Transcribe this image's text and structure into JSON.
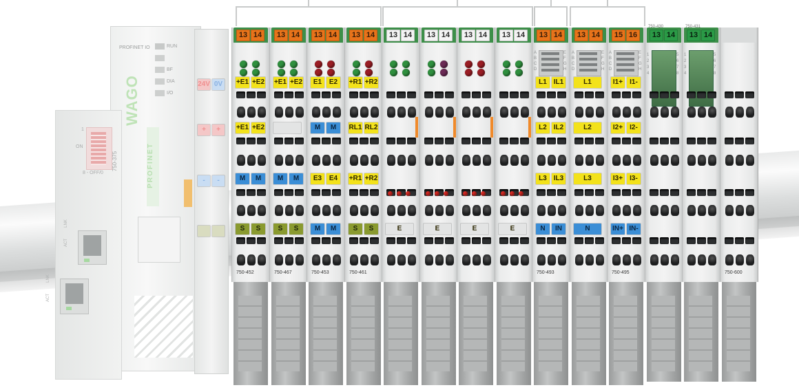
{
  "bracket_groups": 6,
  "coupler": {
    "brand": "WAGO",
    "protocol_label": "PROFINET IO",
    "led_labels": [
      "RUN",
      "BF",
      "DIA",
      "I/O"
    ],
    "model": "750-375",
    "dip_on": "ON",
    "dip_scale": "8 - OFF/0",
    "dip_one": "1",
    "port_labels": [
      "ACT",
      "LNK"
    ],
    "logo_text": "PROFINET"
  },
  "power_module": {
    "top_labels": [
      "24V",
      "0V"
    ],
    "mid_labels": [
      "+",
      "+"
    ],
    "low_labels": [
      "-",
      "-"
    ],
    "bottom_labels": [
      "",
      ""
    ]
  },
  "modules": [
    {
      "id": "m1",
      "nums": [
        "13",
        "14"
      ],
      "num_color": "#e8731a",
      "num_text_color": "#3a1e08",
      "led_colors": [
        "#2f8f3e",
        "#2f8f3e"
      ],
      "row1": [
        "+E1",
        "+E2"
      ],
      "row1_color": "#f3e21b",
      "row2": [
        "+E1",
        "+E2"
      ],
      "row2_color": "#f3e21b",
      "row3": [
        "M",
        "M"
      ],
      "row3_color": "#3b8ed6",
      "row4": [
        "S",
        "S"
      ],
      "row4_color": "#8a9a2f",
      "model": "750-452"
    },
    {
      "id": "m2",
      "nums": [
        "13",
        "14"
      ],
      "num_color": "#e8731a",
      "num_text_color": "#3a1e08",
      "led_colors": [
        "#2f8f3e",
        "#2f8f3e"
      ],
      "row1": [
        "+E1",
        "+E2"
      ],
      "row1_color": "#f3e21b",
      "row2": [
        "",
        ""
      ],
      "row2_color": "#e3e4e4",
      "row3": [
        "M",
        "M"
      ],
      "row3_color": "#3b8ed6",
      "row4": [
        "S",
        "S"
      ],
      "row4_color": "#8a9a2f",
      "model": "750-467"
    },
    {
      "id": "m3",
      "nums": [
        "13",
        "14"
      ],
      "num_color": "#e8731a",
      "num_text_color": "#3a1e08",
      "led_colors": [
        "#9a1d24",
        "#9a1d24"
      ],
      "row1": [
        "E1",
        "E2"
      ],
      "row1_color": "#f3e21b",
      "row2": [
        "M",
        "M"
      ],
      "row2_color": "#3b8ed6",
      "row3": [
        "E3",
        "E4"
      ],
      "row3_color": "#f3e21b",
      "row4": [
        "M",
        "M"
      ],
      "row4_color": "#3b8ed6",
      "model": "750-453"
    },
    {
      "id": "m4",
      "nums": [
        "13",
        "14"
      ],
      "num_color": "#e8731a",
      "num_text_color": "#3a1e08",
      "led_colors": [
        "#2f8f3e",
        "#9a1d24"
      ],
      "row1": [
        "+R1",
        "+R2"
      ],
      "row1_color": "#f3e21b",
      "row2": [
        "RL1",
        "RL2"
      ],
      "row2_color": "#f3e21b",
      "row3": [
        "+R1",
        "+R2"
      ],
      "row3_color": "#f3e21b",
      "row4": [
        "S",
        "S"
      ],
      "row4_color": "#8a9a2f",
      "model": "750-461"
    },
    {
      "id": "m5",
      "nums": [
        "13",
        "14"
      ],
      "num_color": "#f4f4f4",
      "num_text_color": "#2a2a2a",
      "led_colors": [
        "#2f8f3e",
        "#2f8f3e"
      ],
      "row1": [
        "",
        ""
      ],
      "row1_color": "",
      "row2": [
        "",
        ""
      ],
      "row2_color": "",
      "row3": [
        "",
        ""
      ],
      "row3_color": "",
      "row4": [
        "E",
        ""
      ],
      "row4_color": "#e3e4e4",
      "model": ""
    },
    {
      "id": "m6",
      "nums": [
        "13",
        "14"
      ],
      "num_color": "#f4f4f4",
      "num_text_color": "#2a2a2a",
      "led_colors": [
        "#2f8f3e",
        "#6b2a55"
      ],
      "row1": [
        "",
        ""
      ],
      "row1_color": "",
      "row2": [
        "",
        ""
      ],
      "row2_color": "",
      "row3": [
        "",
        ""
      ],
      "row3_color": "",
      "row4": [
        "E",
        ""
      ],
      "row4_color": "#e3e4e4",
      "model": ""
    },
    {
      "id": "m7",
      "nums": [
        "13",
        "14"
      ],
      "num_color": "#f4f4f4",
      "num_text_color": "#2a2a2a",
      "led_colors": [
        "#9a1d24",
        "#9a1d24"
      ],
      "row1": [
        "",
        ""
      ],
      "row1_color": "",
      "row2": [
        "",
        ""
      ],
      "row2_color": "",
      "row3": [
        "",
        ""
      ],
      "row3_color": "",
      "row4": [
        "E",
        ""
      ],
      "row4_color": "#e3e4e4",
      "model": ""
    },
    {
      "id": "m8",
      "nums": [
        "13",
        "14"
      ],
      "num_color": "#f4f4f4",
      "num_text_color": "#2a2a2a",
      "led_colors": [
        "#2f8f3e",
        "#2f8f3e"
      ],
      "row1": [
        "",
        ""
      ],
      "row1_color": "",
      "row2": [
        "",
        ""
      ],
      "row2_color": "",
      "row3": [
        "",
        ""
      ],
      "row3_color": "",
      "row4": [
        "E",
        ""
      ],
      "row4_color": "#e3e4e4",
      "model": ""
    },
    {
      "id": "m9",
      "nums": [
        "13",
        "14"
      ],
      "num_color": "#e8731a",
      "num_text_color": "#3a1e08",
      "led_colors": [],
      "row1": [
        "L1",
        "IL1"
      ],
      "row1_color": "#f3e21b",
      "row2": [
        "L2",
        "IL2"
      ],
      "row2_color": "#f3e21b",
      "row3": [
        "L3",
        "IL3"
      ],
      "row3_color": "#f3e21b",
      "row4": [
        "N",
        "IN"
      ],
      "row4_color": "#3b8ed6",
      "model": "750-493"
    },
    {
      "id": "m10",
      "nums": [
        "13",
        "14"
      ],
      "num_color": "#e8731a",
      "num_text_color": "#3a1e08",
      "led_colors": [],
      "row1": [
        "L1",
        ""
      ],
      "row1_color": "#f3e21b",
      "row2": [
        "L2",
        ""
      ],
      "row2_color": "#f3e21b",
      "row3": [
        "L3",
        ""
      ],
      "row3_color": "#f3e21b",
      "row4": [
        "N",
        ""
      ],
      "row4_color": "#3b8ed6",
      "model": ""
    },
    {
      "id": "m11",
      "nums": [
        "15",
        "16"
      ],
      "num_color": "#e8731a",
      "num_text_color": "#3a1e08",
      "led_colors": [],
      "row1": [
        "I1+",
        "I1-"
      ],
      "row1_color": "#f3e21b",
      "row2": [
        "I2+",
        "I2-"
      ],
      "row2_color": "#f3e21b",
      "row3": [
        "I3+",
        "I3-"
      ],
      "row3_color": "#f3e21b",
      "row4": [
        "IN+",
        "IN-"
      ],
      "row4_color": "#3b8ed6",
      "model": "750-495"
    },
    {
      "id": "m12",
      "nums": [
        "13",
        "14"
      ],
      "num_color": "#2a9a46",
      "num_text_color": "#08220f",
      "led_colors": [],
      "row1": [
        "",
        ""
      ],
      "row1_color": "",
      "row2": [
        "",
        ""
      ],
      "row2_color": "",
      "row3": [
        "",
        ""
      ],
      "row3_color": "",
      "row4": [
        "",
        ""
      ],
      "row4_color": "",
      "model": "",
      "header": "750-430"
    },
    {
      "id": "m13",
      "nums": [
        "13",
        "14"
      ],
      "num_color": "#2a9a46",
      "num_text_color": "#08220f",
      "led_colors": [],
      "row1": [
        "",
        ""
      ],
      "row1_color": "",
      "row2": [
        "",
        ""
      ],
      "row2_color": "",
      "row3": [
        "",
        ""
      ],
      "row3_color": "",
      "row4": [
        "",
        ""
      ],
      "row4_color": "",
      "model": "",
      "header": "750-431"
    },
    {
      "id": "m14",
      "nums": [
        "",
        ""
      ],
      "num_color": "",
      "num_text_color": "",
      "led_colors": [],
      "row1": [
        "",
        ""
      ],
      "row1_color": "",
      "row2": [
        "",
        ""
      ],
      "row2_color": "",
      "row3": [
        "",
        ""
      ],
      "row3_color": "",
      "row4": [
        "",
        ""
      ],
      "row4_color": "",
      "model": "750-600"
    }
  ],
  "abcd_labels": [
    "A",
    "B",
    "C",
    "D"
  ],
  "efgh_labels": [
    "E",
    "F",
    "G",
    "H"
  ],
  "channel_labels_left": [
    "1",
    "2",
    "3",
    "4"
  ],
  "channel_labels_right": [
    "5",
    "6",
    "7",
    "8"
  ]
}
